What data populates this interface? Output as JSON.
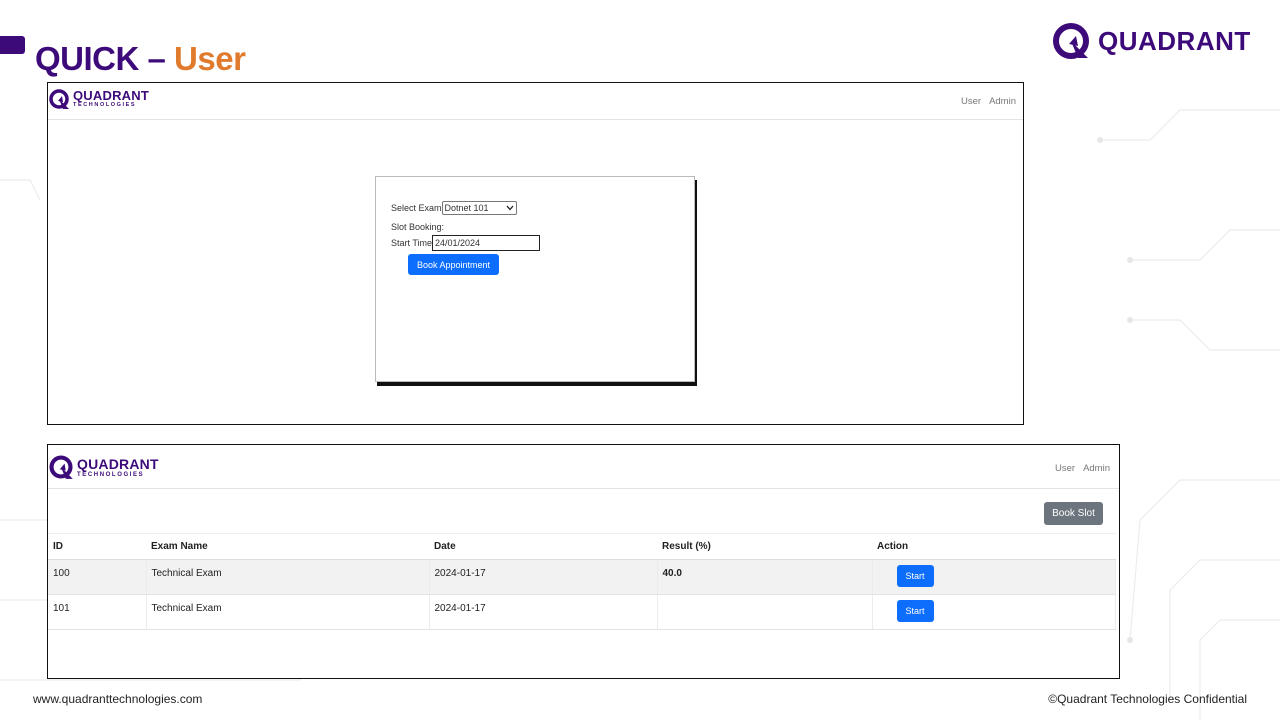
{
  "slide": {
    "title_part1": "QUICK",
    "title_dash": "–",
    "title_part2": "User",
    "brand": "QUADRANT",
    "footer_left": "www.quadranttechnologies.com",
    "footer_right": "©Quadrant Technologies Confidential",
    "colors": {
      "brand_purple": "#3d0a7a",
      "accent_orange": "#e07b2e",
      "primary_blue": "#0d6efd",
      "secondary_gray": "#6c757d"
    }
  },
  "app1": {
    "logo_line1": "QUADRANT",
    "logo_line2": "TECHNOLOGIES",
    "nav": {
      "user": "User",
      "admin": "Admin"
    },
    "form": {
      "select_exam_label": "Select Exam",
      "select_exam_value": "Dotnet 101",
      "slot_booking_label": "Slot Booking:",
      "start_time_label": "Start Time",
      "start_time_value": "24/01/2024",
      "book_button": "Book Appointment"
    }
  },
  "app2": {
    "logo_line1": "QUADRANT",
    "logo_line2": "TECHNOLOGIES",
    "nav": {
      "user": "User",
      "admin": "Admin"
    },
    "book_slot_button": "Book Slot",
    "table": {
      "headers": [
        "ID",
        "Exam Name",
        "Date",
        "Result (%)",
        "Action"
      ],
      "rows": [
        {
          "id": "100",
          "exam_name": "Technical Exam",
          "date": "2024-01-17",
          "result": "40.0",
          "action": "Start"
        },
        {
          "id": "101",
          "exam_name": "Technical Exam",
          "date": "2024-01-17",
          "result": "",
          "action": "Start"
        }
      ]
    }
  }
}
